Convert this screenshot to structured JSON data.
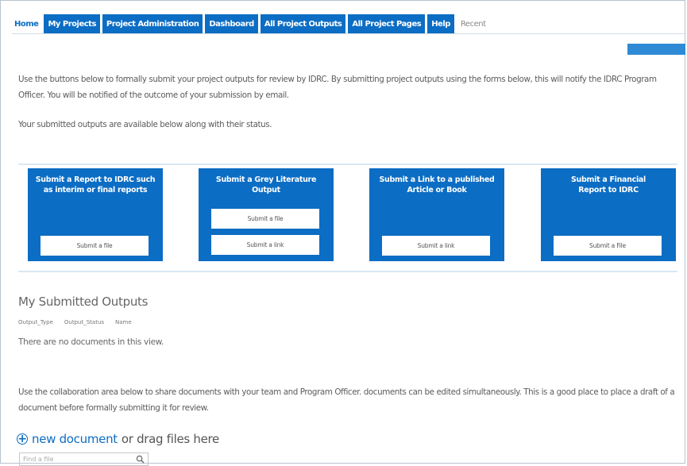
{
  "nav": {
    "tabs": [
      {
        "label": "Home"
      },
      {
        "label": "My Projects"
      },
      {
        "label": "Project Administration"
      },
      {
        "label": "Dashboard"
      },
      {
        "label": "All Project Outputs"
      },
      {
        "label": "All Project Pages"
      },
      {
        "label": "Help"
      },
      {
        "label": "Recent"
      }
    ]
  },
  "intro": {
    "paragraph1": "Use the buttons below to formally submit your project outputs for review by IDRC. By submitting project outputs using the forms below, this will notify the IDRC Program Officer. You will be notified of the outcome of your submission by email.",
    "paragraph2": "Your submitted outputs are available below along with their status."
  },
  "cards": [
    {
      "title": "Submit a Report to IDRC such as interim or final reports",
      "buttons": [
        "Submit a file"
      ]
    },
    {
      "title": "Submit a Grey Literature Output",
      "buttons": [
        "Submit a file",
        "Submit a link"
      ]
    },
    {
      "title": "Submit a Link to a published Article or Book",
      "buttons": [
        "Submit a link"
      ]
    },
    {
      "title": "Submit a Financial Report to IDRC",
      "buttons": [
        "Submit a File"
      ]
    }
  ],
  "submitted": {
    "title": "My Submitted Outputs",
    "columns": [
      "Output_Type",
      "Output_Status",
      "Name"
    ],
    "empty_message": "There are no documents in this view."
  },
  "collaboration": {
    "text": "Use the collaboration area below to share documents with your team and Program Officer. documents can be edited simultaneously. This is a good place to place a draft of a document before formally submitting it for review.",
    "new_document_label": "new document",
    "drag_label": "or drag files here",
    "search_placeholder": "Find a file"
  },
  "colors": {
    "accent": "#0c6dc4",
    "divider": "#d9e8f4"
  }
}
